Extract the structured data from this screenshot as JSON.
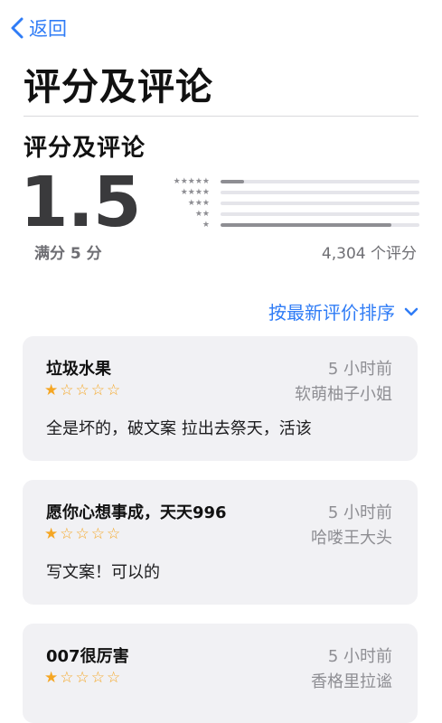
{
  "nav": {
    "back_label": "返回",
    "page_title": "评分及评论"
  },
  "ratings": {
    "section_title": "评分及评论",
    "score": "1.5",
    "out_of": "满分 5 分",
    "count": "4,304 个评分",
    "distribution": [
      {
        "stars": "★★★★★",
        "fraction": 0.12
      },
      {
        "stars": "★★★★",
        "fraction": 0.0
      },
      {
        "stars": "★★★",
        "fraction": 0.0
      },
      {
        "stars": "★★",
        "fraction": 0.0
      },
      {
        "stars": "★",
        "fraction": 0.86
      }
    ]
  },
  "sort": {
    "label": "按最新评价排序"
  },
  "reviews": [
    {
      "title": "垃圾水果",
      "time": "5 小时前",
      "rating": 1,
      "author": "软萌柚子小姐",
      "body": "全是坏的，破文案 拉出去祭天，活该"
    },
    {
      "title": "愿你心想事成，天天996",
      "time": "5 小时前",
      "rating": 1,
      "author": "哈喽王大头",
      "body": "写文案！可以的"
    },
    {
      "title": "007很厉害",
      "time": "5 小时前",
      "rating": 1,
      "author": "香格里拉谧",
      "body": ""
    }
  ]
}
